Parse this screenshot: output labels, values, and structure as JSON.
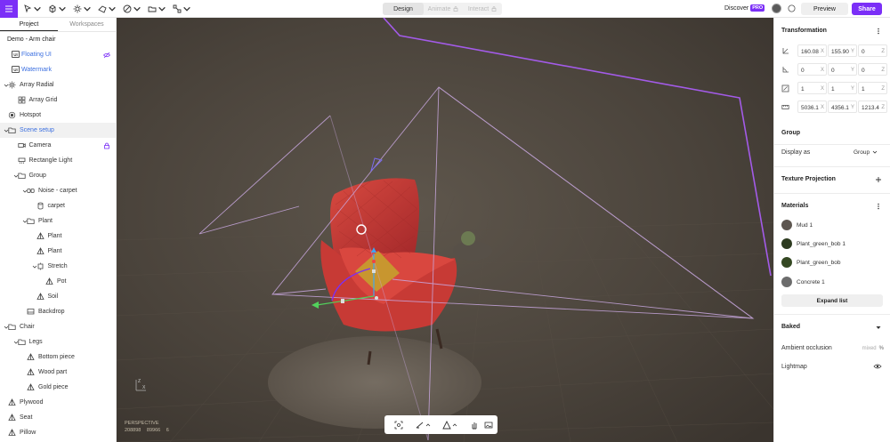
{
  "topbar": {
    "mode_tabs": [
      {
        "label": "Design",
        "active": true,
        "locked": false
      },
      {
        "label": "Animate",
        "active": false,
        "locked": true
      },
      {
        "label": "Interact",
        "active": false,
        "locked": true
      }
    ],
    "discover_label": "Discover",
    "pro_badge": "PRO",
    "preview_label": "Preview",
    "share_label": "Share",
    "accent_color": "#7b2ff7"
  },
  "left_panel": {
    "tabs": [
      "Project",
      "Workspaces"
    ],
    "active_tab": "Project",
    "project_name": "Demo - Arm chair",
    "tree": [
      {
        "label": "Floating UI",
        "icon": "ui-badge-icon",
        "depth": 0,
        "chevron": false,
        "link": true,
        "right_icon": "eye-off-icon"
      },
      {
        "label": "Watermark",
        "icon": "ui-badge-icon",
        "depth": 0,
        "chevron": false,
        "link": true
      },
      {
        "label": "Array Radial",
        "icon": "array-radial-icon",
        "depth": 0,
        "chevron": true
      },
      {
        "label": "Array Grid",
        "icon": "array-grid-icon",
        "depth": 1,
        "chevron": false
      },
      {
        "label": "Hotspot",
        "icon": "hotspot-icon",
        "depth": 0,
        "chevron": false
      },
      {
        "label": "Scene setup",
        "icon": "folder-icon",
        "depth": 0,
        "chevron": true,
        "link": true,
        "selected": true
      },
      {
        "label": "Camera",
        "icon": "camera-icon",
        "depth": 1,
        "chevron": false,
        "right_icon": "lock-icon"
      },
      {
        "label": "Rectangle Light",
        "icon": "rectangle-light-icon",
        "depth": 1,
        "chevron": false
      },
      {
        "label": "Group",
        "icon": "folder-icon",
        "depth": 1,
        "chevron": true
      },
      {
        "label": "Noise - carpet",
        "icon": "noise-icon",
        "depth": 2,
        "chevron": true
      },
      {
        "label": "carpet",
        "icon": "cylinder-icon",
        "depth": 3,
        "chevron": false
      },
      {
        "label": "Plant",
        "icon": "folder-icon",
        "depth": 2,
        "chevron": true
      },
      {
        "label": "Plant",
        "icon": "mesh-icon",
        "depth": 3,
        "chevron": false
      },
      {
        "label": "Plant",
        "icon": "mesh-icon",
        "depth": 3,
        "chevron": false
      },
      {
        "label": "Stretch",
        "icon": "stretch-icon",
        "depth": 3,
        "chevron": true
      },
      {
        "label": "Pot",
        "icon": "mesh-icon",
        "depth": 4,
        "chevron": false
      },
      {
        "label": "Soil",
        "icon": "mesh-icon",
        "depth": 3,
        "chevron": false
      },
      {
        "label": "Backdrop",
        "icon": "backdrop-icon",
        "depth": 2,
        "chevron": false
      },
      {
        "label": "Chair",
        "icon": "folder-icon",
        "depth": 0,
        "chevron": true
      },
      {
        "label": "Legs",
        "icon": "folder-icon",
        "depth": 1,
        "chevron": true
      },
      {
        "label": "Bottom piece",
        "icon": "mesh-icon",
        "depth": 2,
        "chevron": false
      },
      {
        "label": "Wood part",
        "icon": "mesh-icon",
        "depth": 2,
        "chevron": false
      },
      {
        "label": "Gold piece",
        "icon": "mesh-icon",
        "depth": 2,
        "chevron": false
      },
      {
        "label": "Plywood",
        "icon": "mesh-icon",
        "depth": 0,
        "chevron": false
      },
      {
        "label": "Seat",
        "icon": "mesh-icon",
        "depth": 0,
        "chevron": false
      },
      {
        "label": "Pillow",
        "icon": "mesh-icon",
        "depth": 0,
        "chevron": false
      }
    ]
  },
  "viewport": {
    "camera_label": "PERSPECTIVE",
    "stats": [
      "208898",
      "89966",
      "6"
    ],
    "axis_labels": {
      "z": "Z",
      "x": "X"
    }
  },
  "right_panel": {
    "transformation": {
      "title": "Transformation",
      "rows": [
        {
          "icon": "position-icon",
          "fields": [
            {
              "value": "160.08",
              "axis": "X"
            },
            {
              "value": "155.90",
              "axis": "Y"
            },
            {
              "value": "0",
              "axis": "Z"
            }
          ]
        },
        {
          "icon": "rotation-icon",
          "fields": [
            {
              "value": "0",
              "axis": "X"
            },
            {
              "value": "0",
              "axis": "Y"
            },
            {
              "value": "0",
              "axis": "Z"
            }
          ]
        },
        {
          "icon": "scale-icon",
          "fields": [
            {
              "value": "1",
              "axis": "X"
            },
            {
              "value": "1",
              "axis": "Y"
            },
            {
              "value": "1",
              "axis": "Z"
            }
          ]
        },
        {
          "icon": "size-icon",
          "fields": [
            {
              "value": "5036.1",
              "axis": "X"
            },
            {
              "value": "4356.1",
              "axis": "Y"
            },
            {
              "value": "1213.4",
              "axis": "Z"
            }
          ]
        }
      ]
    },
    "group": {
      "title": "Group",
      "display_as_label": "Display as",
      "display_as_value": "Group"
    },
    "texture_projection": {
      "title": "Texture Projection"
    },
    "materials": {
      "title": "Materials",
      "items": [
        {
          "name": "Mud 1",
          "color": "#5d5650"
        },
        {
          "name": "Plant_green_bob 1",
          "color": "#2d3b20"
        },
        {
          "name": "Plant_green_bob",
          "color": "#344822"
        },
        {
          "name": "Concrete 1",
          "color": "#6c6c6c"
        }
      ],
      "expand_label": "Expand list"
    },
    "baked": {
      "title": "Baked",
      "ambient_occlusion_label": "Ambient occlusion",
      "ambient_occlusion_value": "mixed",
      "ambient_occlusion_unit": "%",
      "lightmap_label": "Lightmap"
    }
  }
}
